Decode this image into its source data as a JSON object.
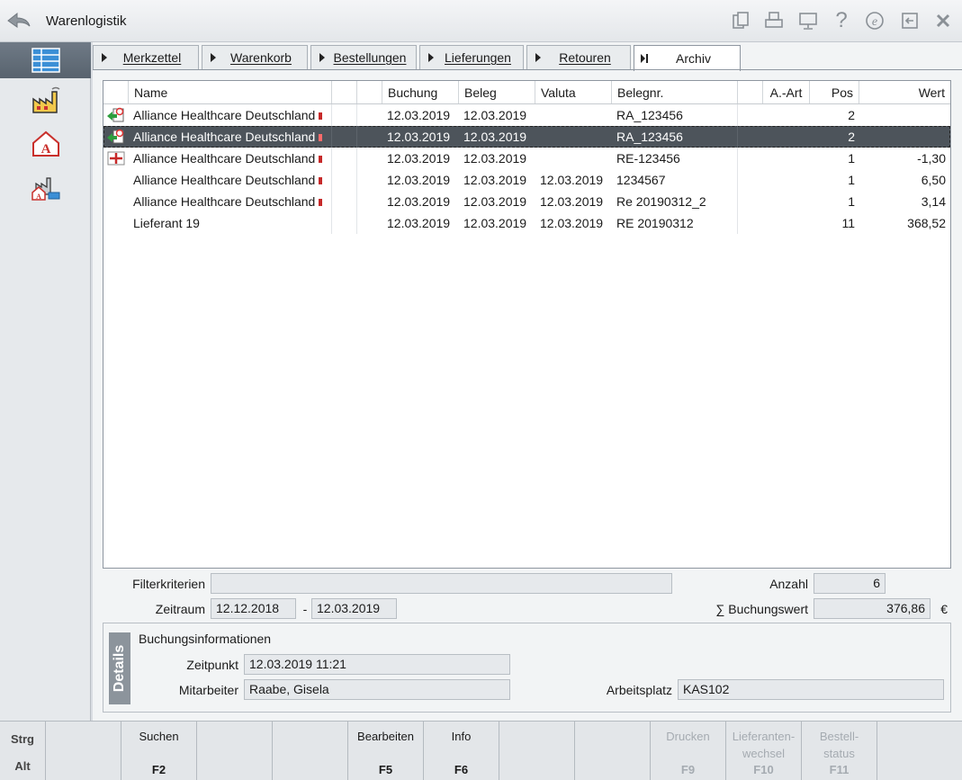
{
  "title": "Warenlogistik",
  "toolbar_icons": [
    "copy-icon",
    "printer-icon",
    "monitor-icon",
    "help-icon",
    "e-icon",
    "exit-window-icon",
    "close-icon"
  ],
  "tabs": [
    {
      "label": "Merkzettel"
    },
    {
      "label": "Warenkorb"
    },
    {
      "label": "Bestellungen"
    },
    {
      "label": "Lieferungen"
    },
    {
      "label": "Retouren"
    },
    {
      "label": "Archiv",
      "active": true
    }
  ],
  "grid": {
    "columns": [
      "Name",
      "",
      "",
      "Buchung",
      "Beleg",
      "Valuta",
      "Belegnr.",
      "",
      "A.-Art",
      "Pos",
      "Wert"
    ],
    "rows": [
      {
        "icon": "return-doc-icon",
        "name": "Alliance Healthcare Deutschland",
        "buchung": "12.03.2019",
        "beleg": "12.03.2019",
        "valuta": "",
        "belegnr": "RA_123456",
        "aart": "",
        "pos": "2",
        "wert": ""
      },
      {
        "icon": "return-doc-icon",
        "name": "Alliance Healthcare Deutschland",
        "buchung": "12.03.2019",
        "beleg": "12.03.2019",
        "valuta": "",
        "belegnr": "RA_123456",
        "aart": "",
        "pos": "2",
        "wert": "",
        "selected": true
      },
      {
        "icon": "invoice-red-icon",
        "name": "Alliance Healthcare Deutschland",
        "buchung": "12.03.2019",
        "beleg": "12.03.2019",
        "valuta": "",
        "belegnr": "RE-123456",
        "aart": "",
        "pos": "1",
        "wert": "-1,30"
      },
      {
        "icon": "",
        "name": "Alliance Healthcare Deutschland",
        "buchung": "12.03.2019",
        "beleg": "12.03.2019",
        "valuta": "12.03.2019",
        "belegnr": "1234567",
        "aart": "",
        "pos": "1",
        "wert": "6,50"
      },
      {
        "icon": "",
        "name": "Alliance Healthcare Deutschland",
        "buchung": "12.03.2019",
        "beleg": "12.03.2019",
        "valuta": "12.03.2019",
        "belegnr": "Re 20190312_2",
        "aart": "",
        "pos": "1",
        "wert": "3,14"
      },
      {
        "icon": "",
        "name": "Lieferant 19",
        "buchung": "12.03.2019",
        "beleg": "12.03.2019",
        "valuta": "12.03.2019",
        "belegnr": "RE 20190312",
        "aart": "",
        "pos": "11",
        "wert": "368,52"
      }
    ]
  },
  "filter": {
    "filterkriterien_label": "Filterkriterien",
    "filterkriterien_value": "",
    "zeitraum_label": "Zeitraum",
    "zeitraum_from": "12.12.2018",
    "zeitraum_sep": "-",
    "zeitraum_to": "12.03.2019",
    "anzahl_label": "Anzahl",
    "anzahl_value": "6",
    "buchungswert_label": "∑ Buchungswert",
    "buchungswert_value": "376,86",
    "currency": "€"
  },
  "details": {
    "tag": "Details",
    "heading": "Buchungsinformationen",
    "zeitpunkt_label": "Zeitpunkt",
    "zeitpunkt_value": "12.03.2019 11:21",
    "mitarbeiter_label": "Mitarbeiter",
    "mitarbeiter_value": "Raabe, Gisela",
    "arbeitsplatz_label": "Arbeitsplatz",
    "arbeitsplatz_value": "KAS102"
  },
  "fkeys": [
    {
      "top": "Strg",
      "bottom": "Alt"
    },
    {
      "label": "",
      "key": ""
    },
    {
      "label": "Suchen",
      "key": "F2"
    },
    {
      "label": "",
      "key": ""
    },
    {
      "label": "",
      "key": ""
    },
    {
      "label": "Bearbeiten",
      "key": "F5"
    },
    {
      "label": "Info",
      "key": "F6"
    },
    {
      "label": "",
      "key": ""
    },
    {
      "label": "",
      "key": ""
    },
    {
      "label": "Drucken",
      "key": "F9",
      "disabled": true
    },
    {
      "label": "Lieferanten-\nwechsel",
      "key": "F10",
      "disabled": true
    },
    {
      "label": "Bestell-\nstatus",
      "key": "F11",
      "disabled": true
    },
    {
      "label": "",
      "key": ""
    }
  ]
}
